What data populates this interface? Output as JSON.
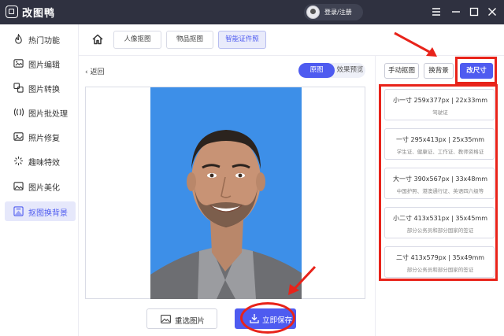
{
  "app": {
    "title": "改图鸭",
    "login": "登录/注册"
  },
  "window_controls": [
    "menu-icon",
    "minimize-icon",
    "maximize-icon",
    "close-icon"
  ],
  "sidebar": {
    "items": [
      {
        "label": "热门功能",
        "icon": "fire-icon",
        "active": false
      },
      {
        "label": "图片编辑",
        "icon": "image-edit-icon",
        "active": false
      },
      {
        "label": "图片转换",
        "icon": "convert-icon",
        "active": false
      },
      {
        "label": "图片批处理",
        "icon": "batch-icon",
        "active": false
      },
      {
        "label": "照片修复",
        "icon": "photo-repair-icon",
        "active": false
      },
      {
        "label": "趣味特效",
        "icon": "sparkle-icon",
        "active": false
      },
      {
        "label": "图片美化",
        "icon": "beautify-icon",
        "active": false
      },
      {
        "label": "抠图换背景",
        "icon": "cutout-icon",
        "active": true
      }
    ]
  },
  "tabs": [
    {
      "label": "人像抠图",
      "active": false
    },
    {
      "label": "物品抠图",
      "active": false
    },
    {
      "label": "智能证件照",
      "active": true
    }
  ],
  "back_label": "返回",
  "view_toggle": {
    "original": "原图",
    "preview": "效果预览",
    "selected": "原图"
  },
  "photo": {
    "background_color": "#3d8fe8"
  },
  "actions": {
    "reselect": "重选图片",
    "save": "立即保存"
  },
  "right_tools": {
    "manual_cutout": "手动抠图",
    "change_background": "换背景",
    "change_size": "改尺寸"
  },
  "sizes": [
    {
      "title": "小一寸 259x377px | 22x33mm",
      "subtitle": "驾驶证"
    },
    {
      "title": "一寸 295x413px | 25x35mm",
      "subtitle": "学生证、健康证、工作证、教师资格证"
    },
    {
      "title": "大一寸 390x567px | 33x48mm",
      "subtitle": "中国护照、港澳通行证、英语四六级等"
    },
    {
      "title": "小二寸 413x531px | 35x45mm",
      "subtitle": "部分公务员和部分国家的签证"
    },
    {
      "title": "二寸 413x579px | 35x49mm",
      "subtitle": "部分公务员和部分国家的签证"
    }
  ],
  "colors": {
    "accent": "#4e5bf0",
    "titlebar": "#2f3140",
    "annotation": "#e8231a"
  }
}
